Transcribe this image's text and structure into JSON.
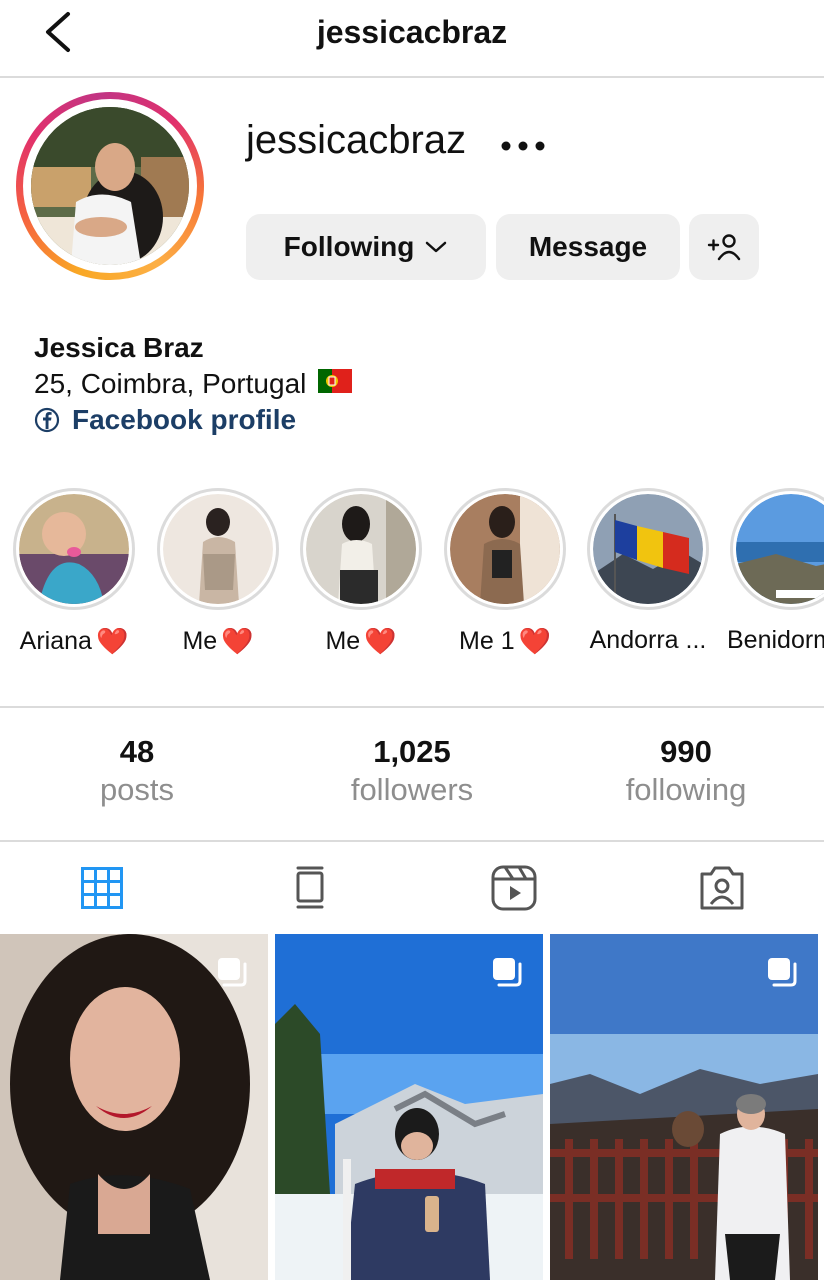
{
  "header": {
    "title": "jessicacbraz",
    "back_icon": "chevron-left-icon"
  },
  "profile": {
    "username": "jessicacbraz",
    "more_icon": "ellipsis-icon",
    "buttons": {
      "following": "Following",
      "message": "Message",
      "add_user_icon": "add-person-icon"
    },
    "name": "Jessica Braz",
    "bio_line": "25, Coimbra, Portugal",
    "bio_flag": "🇵🇹",
    "link_label": "Facebook profile",
    "link_icon": "facebook-icon"
  },
  "highlights": [
    {
      "label": "Ariana",
      "emoji": "❤️"
    },
    {
      "label": "Me",
      "emoji": "❤️"
    },
    {
      "label": "Me",
      "emoji": "❤️"
    },
    {
      "label": "Me 1",
      "emoji": "❤️"
    },
    {
      "label": "Andorra ...",
      "emoji": ""
    },
    {
      "label": "Benidorm",
      "emoji": ""
    }
  ],
  "stats": [
    {
      "value": "48",
      "label": "posts"
    },
    {
      "value": "1,025",
      "label": "followers"
    },
    {
      "value": "990",
      "label": "following"
    }
  ],
  "tabs": [
    {
      "name": "grid",
      "icon": "grid-icon",
      "active": true
    },
    {
      "name": "guides",
      "icon": "guide-icon",
      "active": false
    },
    {
      "name": "reels",
      "icon": "reels-icon",
      "active": false
    },
    {
      "name": "tagged",
      "icon": "tagged-person-icon",
      "active": false
    }
  ],
  "colors": {
    "active_tab": "#2196f3",
    "link": "#1c3e66",
    "muted": "#8e8e8e",
    "heart": "#e8222e"
  }
}
